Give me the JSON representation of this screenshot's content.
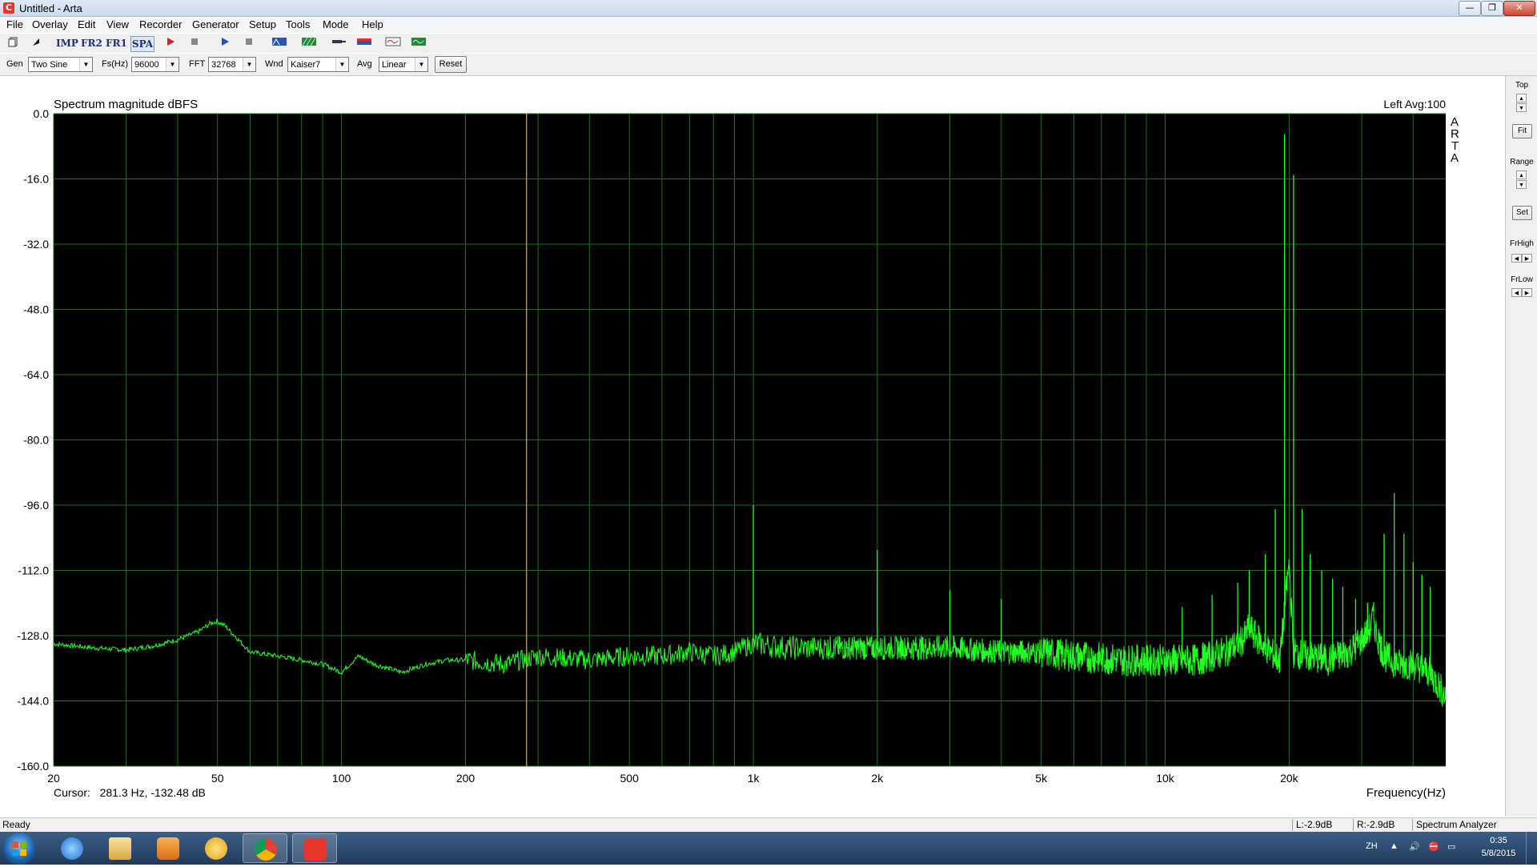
{
  "window": {
    "title": "Untitled - Arta",
    "app_icon": "C",
    "buttons": {
      "minimize": "—",
      "restore": "❐",
      "close": "✕"
    }
  },
  "menu": [
    "File",
    "Overlay",
    "Edit",
    "View",
    "Recorder",
    "Generator",
    "Setup",
    "Tools",
    "Mode",
    "Help"
  ],
  "toolbar": {
    "imp": "IMP",
    "fr2": "FR2",
    "fr1": "FR1",
    "spa": "SPA"
  },
  "params": {
    "gen_label": "Gen",
    "gen_value": "Two Sine",
    "fs_label": "Fs(Hz)",
    "fs_value": "96000",
    "fft_label": "FFT",
    "fft_value": "32768",
    "wnd_label": "Wnd",
    "wnd_value": "Kaiser7",
    "avg_label": "Avg",
    "avg_value": "Linear",
    "reset_label": "Reset"
  },
  "side": {
    "top": "Top",
    "fit": "Fit",
    "range": "Range",
    "set": "Set",
    "frhigh": "FrHigh",
    "frlow": "FrLow"
  },
  "status": {
    "ready": "Ready",
    "left_level": "L:-2.9dB",
    "right_level": "R:-2.9dB",
    "mode": "Spectrum Analyzer"
  },
  "tray": {
    "lang": "ZH",
    "time": "0:35",
    "date": "5/8/2015"
  },
  "colors": {
    "plot_bg": "#000000",
    "grid": "#1e6e1e",
    "trace": "#23ff23",
    "cursor": "#b0a000"
  },
  "chart_data": {
    "type": "line",
    "title": "Spectrum magnitude dBFS",
    "channel_info": "Left  Avg:100",
    "watermark": [
      "A",
      "R",
      "T",
      "A"
    ],
    "xlabel": "Frequency(Hz)",
    "x_scale": "log",
    "xlim": [
      20,
      48000
    ],
    "ylim": [
      -160,
      0
    ],
    "x_ticks": [
      20,
      50,
      100,
      200,
      500,
      1000,
      2000,
      5000,
      10000,
      20000
    ],
    "x_tick_labels": [
      "20",
      "50",
      "100",
      "200",
      "500",
      "1k",
      "2k",
      "5k",
      "10k",
      "20k"
    ],
    "y_ticks": [
      0,
      -16,
      -32,
      -48,
      -64,
      -80,
      -96,
      -112,
      -128,
      -144,
      -160
    ],
    "y_tick_labels": [
      "0.0",
      "-16.0",
      "-32.0",
      "-48.0",
      "-64.0",
      "-80.0",
      "-96.0",
      "-112.0",
      "-128.0",
      "-144.0",
      "-160.0"
    ],
    "cursor": {
      "freq": 281.3,
      "db": -132.48,
      "text": "Cursor:   281.3 Hz, -132.48 dB"
    },
    "series": [
      {
        "x": [
          20,
          25,
          30,
          35,
          40,
          45,
          48,
          50,
          52,
          55,
          60,
          70,
          80,
          90,
          100,
          110,
          120,
          140,
          160,
          180,
          200,
          250,
          300,
          400,
          500,
          600,
          700,
          800,
          900,
          990,
          1000,
          1010,
          1200,
          1500,
          1900,
          2000,
          2100,
          2500,
          3000,
          4000,
          5000,
          6000,
          8000,
          10000,
          12000,
          14000,
          15500,
          16000,
          16500,
          18000,
          19000,
          19500,
          20000,
          20500,
          22000,
          25000,
          28000,
          30000,
          31500,
          32000,
          32500,
          34000,
          37000,
          40000,
          44000,
          48000
        ],
        "y": [
          -130,
          -131,
          -131.5,
          -130.5,
          -129,
          -127,
          -125,
          -124.5,
          -125.5,
          -128,
          -132,
          -133,
          -134,
          -135,
          -137,
          -133,
          -135,
          -137,
          -135,
          -134,
          -134,
          -135,
          -133,
          -134,
          -133,
          -133,
          -132,
          -133,
          -132,
          -130,
          -96,
          -130,
          -131,
          -131,
          -131,
          -107,
          -131,
          -131,
          -131,
          -132,
          -132,
          -133,
          -134,
          -134,
          -134,
          -132,
          -129,
          -126,
          -128,
          -132,
          -134,
          -52,
          -110,
          -132,
          -133,
          -134,
          -132,
          -129,
          -126,
          -123,
          -127,
          -133,
          -135,
          -135,
          -137,
          -143
        ]
      }
    ],
    "peaks": [
      {
        "x": 1000,
        "y": -96
      },
      {
        "x": 2000,
        "y": -107
      },
      {
        "x": 3000,
        "y": -117
      },
      {
        "x": 4000,
        "y": -119
      },
      {
        "x": 19500,
        "y": -5
      },
      {
        "x": 20500,
        "y": -15
      },
      {
        "x": 18500,
        "y": -97
      },
      {
        "x": 21500,
        "y": -97
      },
      {
        "x": 36000,
        "y": -93
      },
      {
        "x": 34000,
        "y": -103
      },
      {
        "x": 38000,
        "y": -103
      },
      {
        "x": 17500,
        "y": -108
      },
      {
        "x": 22500,
        "y": -108
      },
      {
        "x": 16000,
        "y": -112
      },
      {
        "x": 24000,
        "y": -112
      },
      {
        "x": 40000,
        "y": -110
      },
      {
        "x": 42000,
        "y": -113
      },
      {
        "x": 44000,
        "y": -116
      },
      {
        "x": 15000,
        "y": -115
      },
      {
        "x": 13000,
        "y": -118
      },
      {
        "x": 11000,
        "y": -121
      },
      {
        "x": 25500,
        "y": -114
      },
      {
        "x": 27000,
        "y": -116
      },
      {
        "x": 29000,
        "y": -119
      },
      {
        "x": 31000,
        "y": -120
      }
    ]
  }
}
